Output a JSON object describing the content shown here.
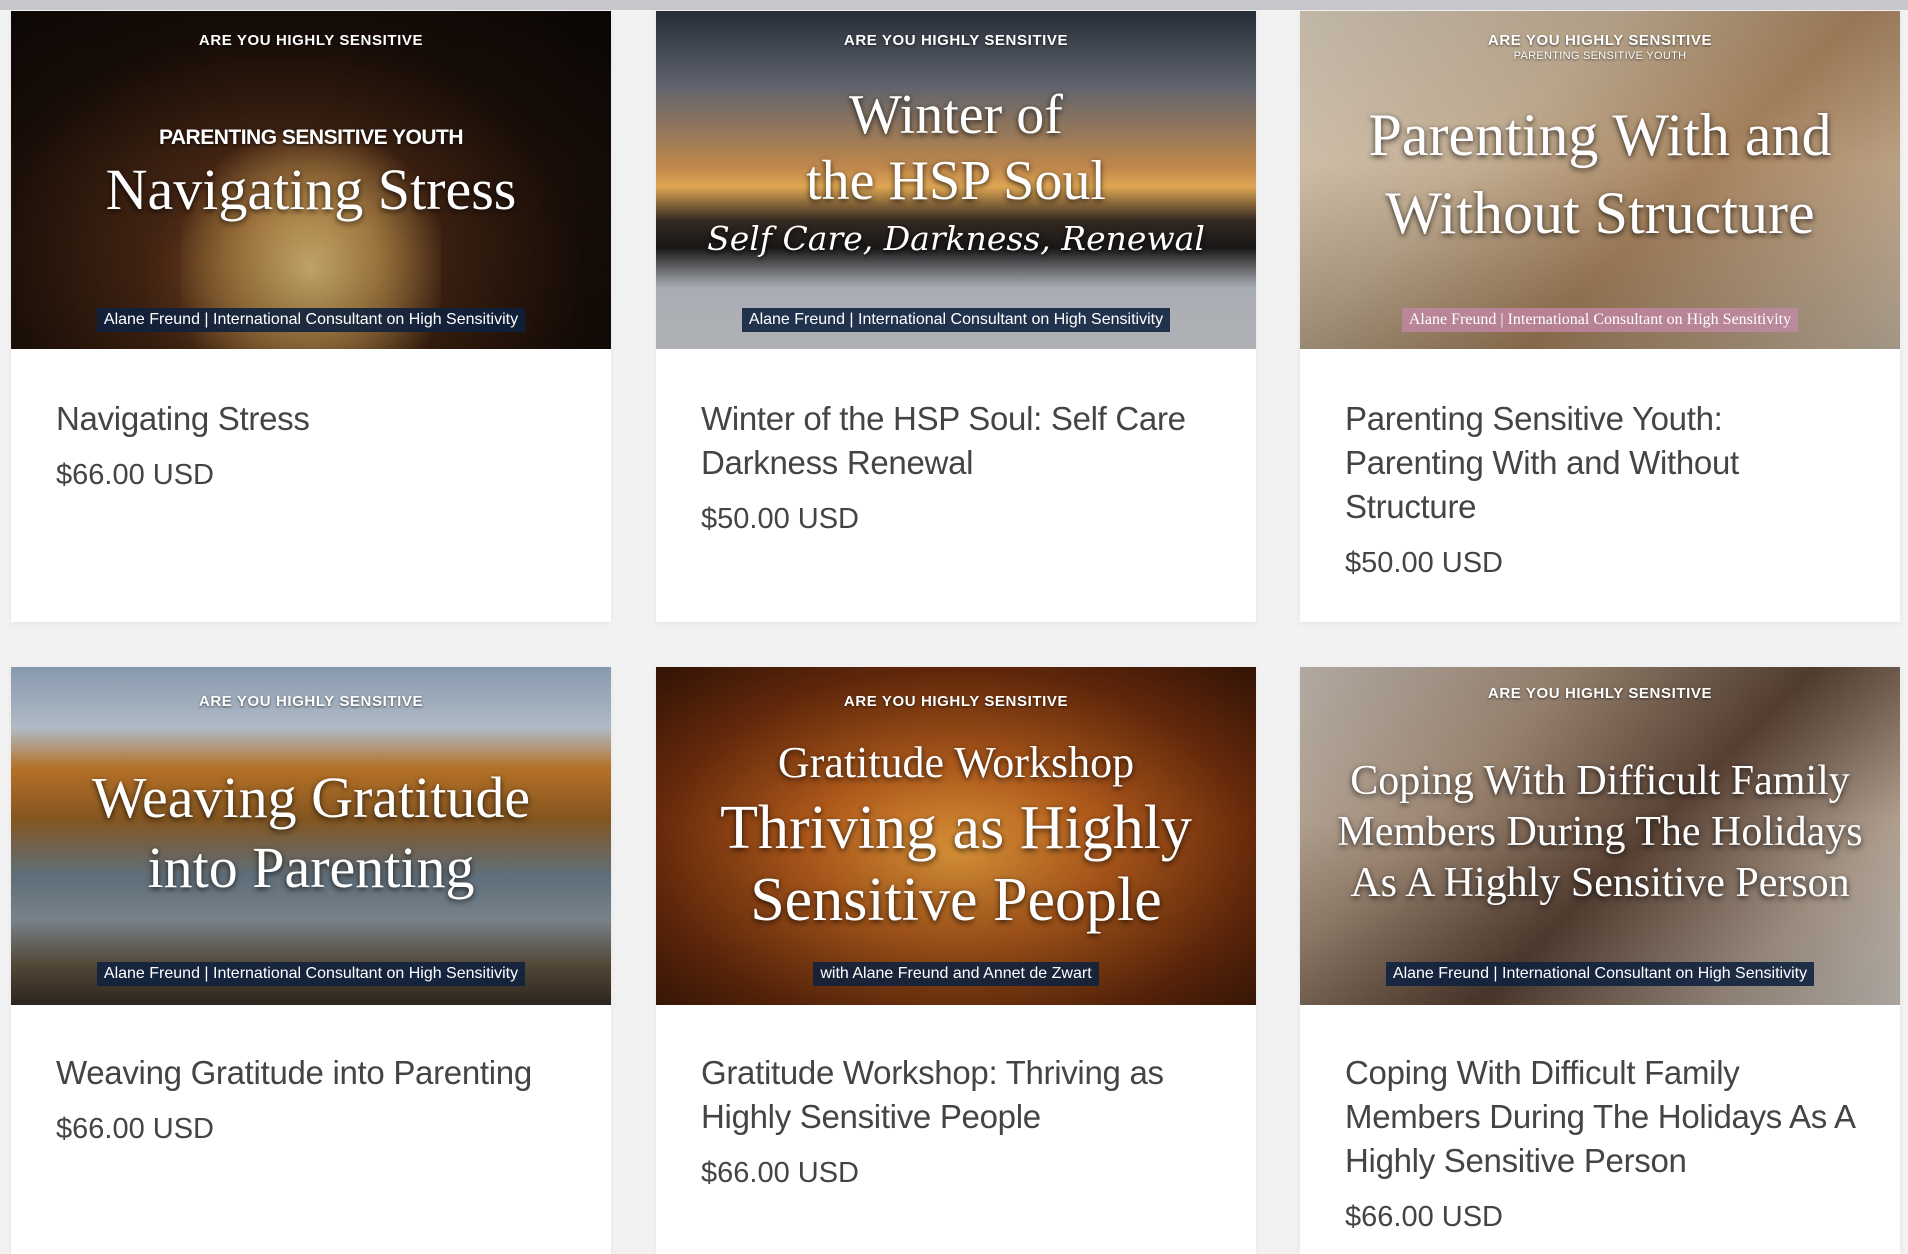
{
  "products": [
    {
      "title": "Navigating Stress",
      "price": "$66.00 USD",
      "image": {
        "kicker": "ARE YOU HIGHLY SENSITIVE",
        "small_title": "PARENTING SENSITIVE YOUTH",
        "title_lines": [
          "Navigating Stress"
        ],
        "banner": "Alane Freund | International Consultant on High Sensitivity"
      }
    },
    {
      "title": "Winter of the HSP Soul: Self Care Darkness Renewal",
      "price": "$50.00 USD",
      "image": {
        "kicker": "ARE YOU HIGHLY SENSITIVE",
        "title_lines": [
          "Winter of",
          "the HSP Soul"
        ],
        "script": "Self Care, Darkness, Renewal",
        "banner": "Alane Freund | International Consultant on High Sensitivity"
      }
    },
    {
      "title": "Parenting Sensitive Youth: Parenting With and Without Structure",
      "price": "$50.00 USD",
      "image": {
        "kicker": "ARE YOU HIGHLY SENSITIVE",
        "sub_kicker": "PARENTING SENSITIVE YOUTH",
        "title_lines": [
          "Parenting With and",
          "Without Structure"
        ],
        "banner": "Alane Freund | International Consultant on High Sensitivity"
      }
    },
    {
      "title": "Weaving Gratitude into Parenting",
      "price": "$66.00 USD",
      "image": {
        "kicker": "ARE YOU HIGHLY SENSITIVE",
        "title_lines": [
          "Weaving Gratitude",
          "into Parenting"
        ],
        "banner": "Alane Freund | International Consultant on High Sensitivity"
      }
    },
    {
      "title": "Gratitude Workshop: Thriving as Highly Sensitive People",
      "price": "$66.00 USD",
      "image": {
        "kicker": "ARE YOU HIGHLY SENSITIVE",
        "pre_title": "Gratitude Workshop",
        "title_lines": [
          "Thriving as Highly",
          "Sensitive People"
        ],
        "banner": "with Alane Freund and Annet de Zwart"
      }
    },
    {
      "title": "Coping With Difficult Family Members During The Holidays As A Highly Sensitive Person",
      "price": "$66.00 USD",
      "image": {
        "kicker": "ARE YOU HIGHLY SENSITIVE",
        "title_lines": [
          "Coping With Difficult Family",
          "Members During The Holidays",
          "As A Highly Sensitive Person"
        ],
        "banner": "Alane Freund | International Consultant on High Sensitivity"
      }
    }
  ]
}
